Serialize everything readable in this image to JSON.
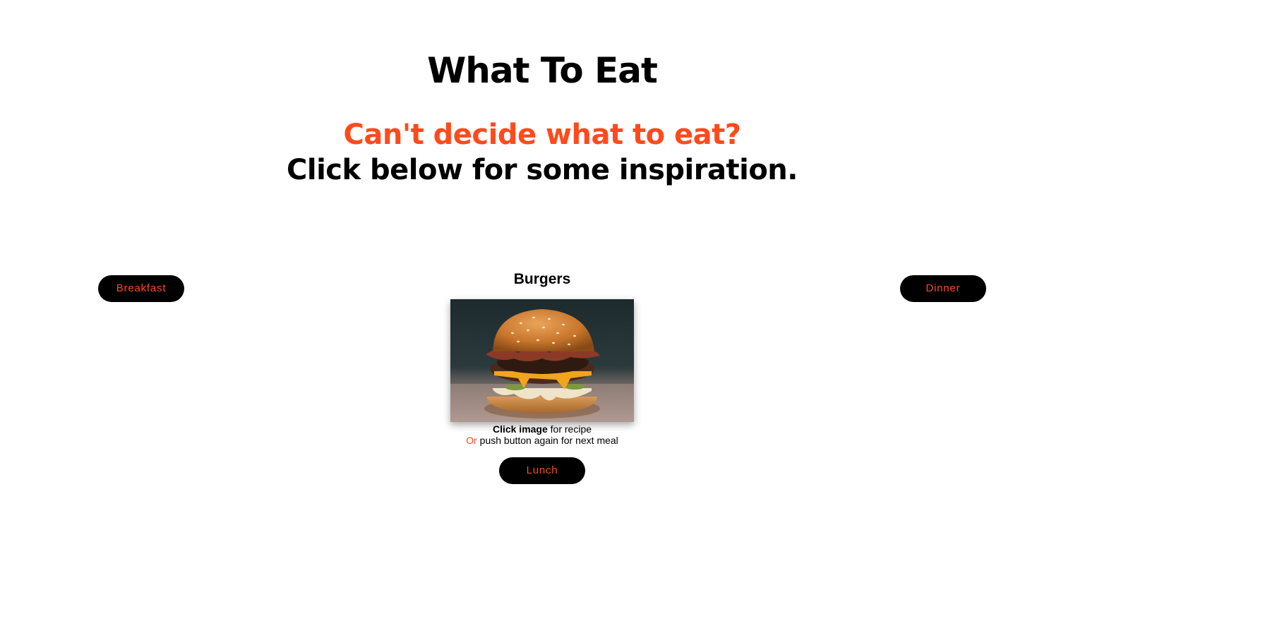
{
  "header": {
    "title": "What To Eat",
    "tagline_accent": "Can't decide what to eat?",
    "tagline_sub": "Click below for some inspiration."
  },
  "buttons": {
    "breakfast": "Breakfast",
    "lunch": "Lunch",
    "dinner": "Dinner"
  },
  "meal": {
    "name": "Burgers",
    "image_icon": "burger-photo"
  },
  "hint": {
    "line1_bold": "Click image",
    "line1_rest": " for recipe",
    "line2_accent": "Or",
    "line2_rest": " push button again for next meal"
  },
  "colors": {
    "accent": "#ff4a1c",
    "button_bg": "#000000",
    "background": "#ffffff"
  }
}
